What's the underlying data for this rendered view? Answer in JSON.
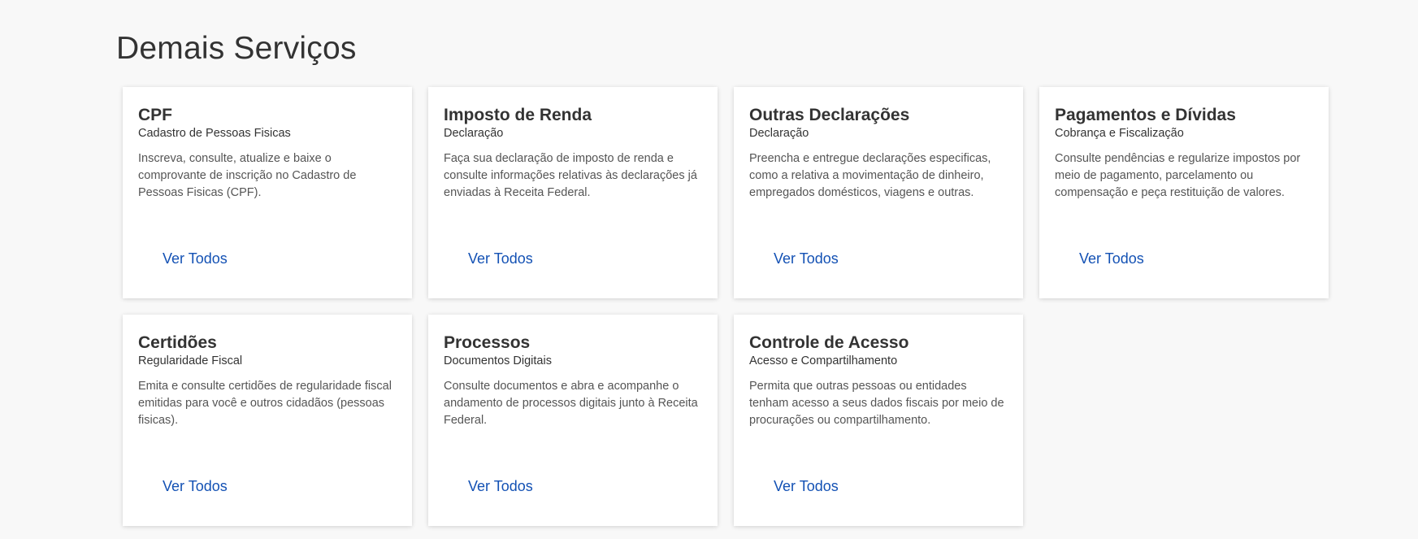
{
  "page": {
    "title": "Demais Serviços"
  },
  "colors": {
    "background": "#f8f8f8",
    "card": "#ffffff",
    "link": "#1351b4",
    "text": "#333333"
  },
  "cards": [
    {
      "title": "CPF",
      "subtitle": "Cadastro de Pessoas Fisicas",
      "description": "Inscreva, consulte, atualize e baixe o comprovante de inscrição no Cadastro de Pessoas Fisicas (CPF).",
      "link": "Ver Todos"
    },
    {
      "title": "Imposto de Renda",
      "subtitle": "Declaração",
      "description": "Faça sua declaração de imposto de renda e consulte informações relativas às declarações já enviadas à Receita Federal.",
      "link": "Ver Todos"
    },
    {
      "title": "Outras Declarações",
      "subtitle": "Declaração",
      "description": "Preencha e entregue declarações especificas, como a relativa a movimentação de dinheiro, empregados domésticos, viagens e outras.",
      "link": "Ver Todos"
    },
    {
      "title": "Pagamentos e Dívidas",
      "subtitle": "Cobrança e Fiscalização",
      "description": "Consulte pendências e regularize impostos por meio de pagamento, parcelamento ou compensação e peça restituição de valores.",
      "link": "Ver Todos"
    },
    {
      "title": "Certidões",
      "subtitle": "Regularidade Fiscal",
      "description": "Emita e consulte certidões de regularidade fiscal emitidas para você e outros cidadãos (pessoas fisicas).",
      "link": "Ver Todos"
    },
    {
      "title": "Processos",
      "subtitle": "Documentos Digitais",
      "description": "Consulte documentos e abra e acompanhe o andamento de processos digitais junto à Receita Federal.",
      "link": "Ver Todos"
    },
    {
      "title": "Controle de Acesso",
      "subtitle": "Acesso e Compartilhamento",
      "description": "Permita que outras pessoas ou entidades tenham acesso a seus dados fiscais por meio de procurações ou compartilhamento.",
      "link": "Ver Todos"
    }
  ]
}
